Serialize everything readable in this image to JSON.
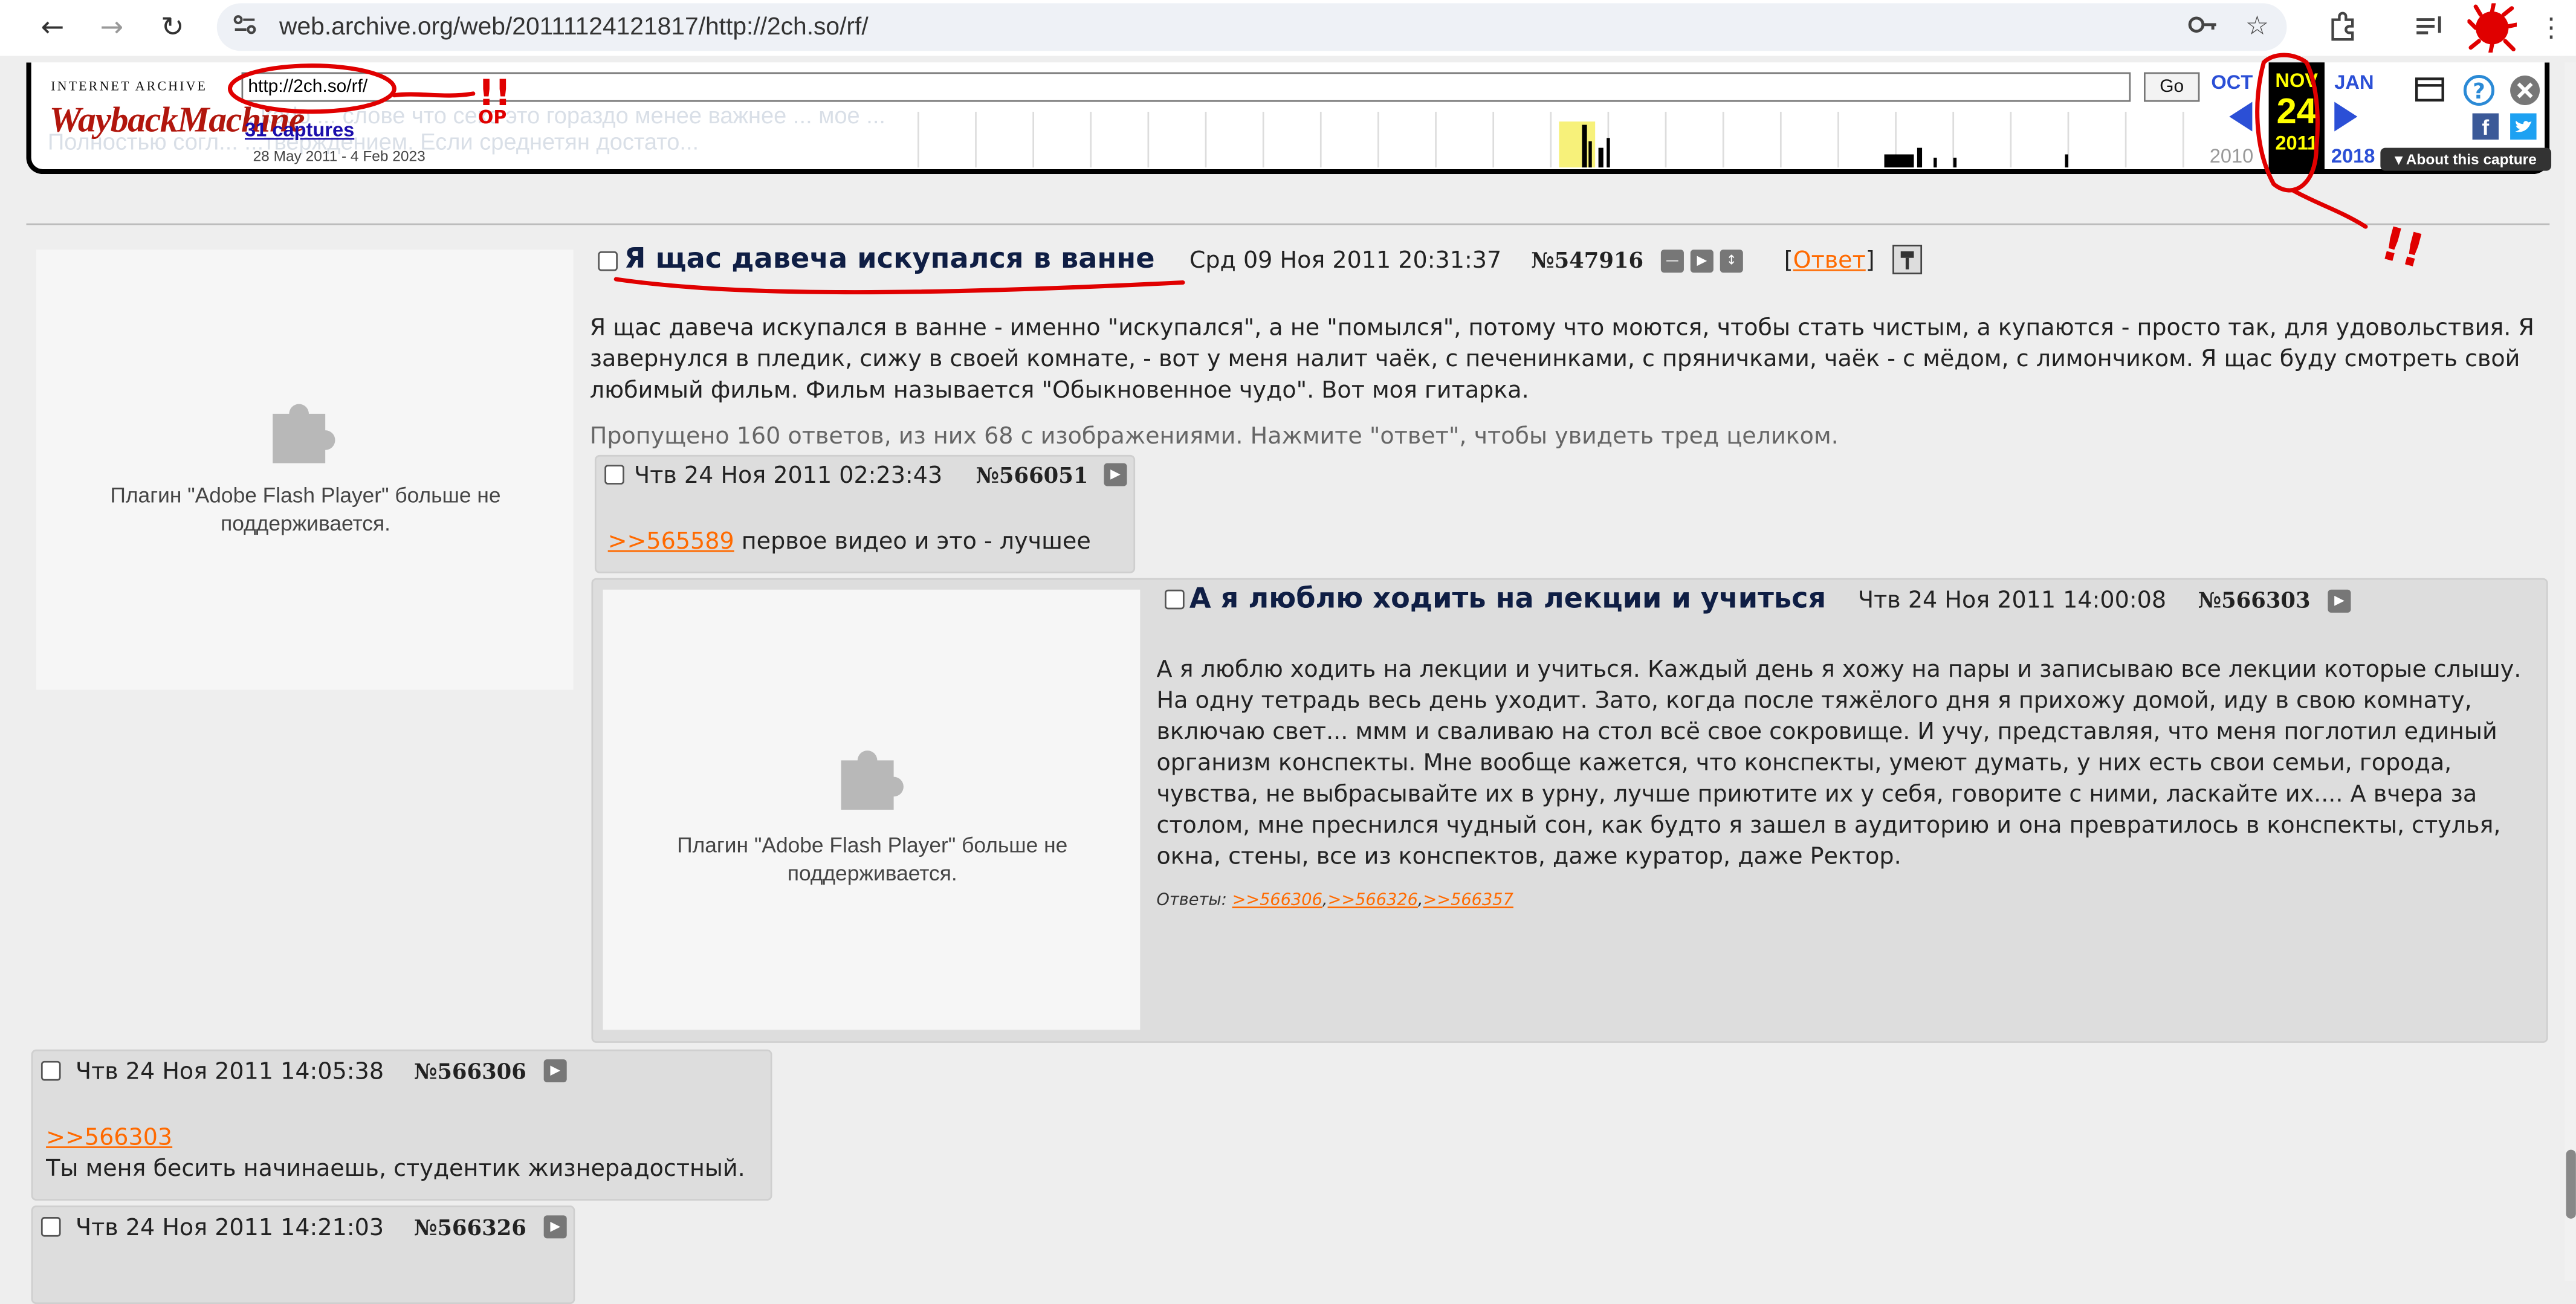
{
  "browser": {
    "url": "web.archive.org/web/20111124121817/http://2ch.so/rf/",
    "icons": [
      "back-icon",
      "forward-icon",
      "reload-icon",
      "site-info-icon",
      "password-key-icon",
      "bookmark-star-icon",
      "extensions-icon",
      "reading-list-icon",
      "profile-avatar-icon",
      "menu-kebab-icon"
    ]
  },
  "wayback": {
    "logo_top": "INTERNET ARCHIVE",
    "logo_main": "WaybackMachine",
    "url_value": "http://2ch.so/rf/",
    "go_label": "Go",
    "captures": "31 captures",
    "range": "28 May 2011 - 4 Feb 2023",
    "months": {
      "prev": "OCT",
      "cur": "NOV",
      "next": "JAN"
    },
    "day": "24",
    "years": {
      "prev": "2010",
      "cur": "2011",
      "next": "2018"
    },
    "about": "About this capture",
    "ghost_line1": "...kado ... слове что секс это гораздо менее важнее ... мое ...",
    "ghost_line2": "Полностью согл... ...тверждением. Если среднетян достато..."
  },
  "plugin_message": "Плагин \"Adobe Flash Player\" больше не поддерживается.",
  "op": {
    "subject": "Я щас давеча искупался в ванне",
    "date": "Срд 09 Ноя 2011 20:31:37",
    "number": "№547916",
    "reply_open": "[",
    "reply_label": "Ответ",
    "reply_close": "]",
    "body": "Я щас давеча искупался в ванне - именно \"искупался\", а не \"помылся\", потому что моются, чтобы стать чистым, а купаются - просто так, для удовольствия. Я завернулся в пледик, сижу в своей комнате, - вот у меня налит чаёк, с печенинками, с пряничками, чаёк - с мёдом, с лимончиком. Я щас буду смотреть свой любимый фильм. Фильм называется \"Обыкновенное чудо\". Вот моя гитарка.",
    "omitted": "Пропущено 160 ответов, из них 68 с изображениями. Нажмите \"ответ\", чтобы увидеть тред целиком."
  },
  "replies": [
    {
      "date": "Чтв 24 Ноя 2011 02:23:43",
      "number": "№566051",
      "link": ">>565589",
      "text": "первое видео и это - лучшее"
    },
    {
      "subject": "А я люблю ходить на лекции и учиться",
      "date": "Чтв 24 Ноя 2011 14:00:08",
      "number": "№566303",
      "text": "А я люблю ходить на лекции и учиться. Каждый день я хожу на пары и записываю все лекции которые слышу. На одну тетрадь весь день уходит. Зато, когда после тяжёлого дня я прихожу домой, иду в свою комнату, включаю свет... ммм и сваливаю на стол всё свое сокровище. И учу, представляя, что меня поглотил единый организм конспекты. Мне вообще кажется, что конспекты, умеют думать, у них есть свои семьи, города, чувства, не выбрасывайте их в урну, лучше приютите их у себя, говорите с ними, ласкайте их.... А вчера за столом, мне преснился чудный сон, как будто я зашел в аудиторию и она превратилось в конспекты, стулья, окна, стены, все из конспектов, даже куратор, даже Ректор.",
      "answers_label": "Ответы:",
      "answers": [
        ">>566306",
        ">>566326",
        ">>566357"
      ]
    },
    {
      "date": "Чтв 24 Ноя 2011 14:05:38",
      "number": "№566306",
      "link": ">>566303",
      "text": "Ты меня бесить начинаешь, студентик жизнерадостный."
    },
    {
      "date": "Чтв 24 Ноя 2011 14:21:03",
      "number": "№566326"
    }
  ],
  "annotations": {
    "marks_left": "!!",
    "marks_left_sub": "ОР",
    "marks_right": "!!"
  },
  "colors": {
    "accent_link": "#ff6a00",
    "subject": "#0f1e44",
    "wayback_red": "#b1160d",
    "wayback_blue": "#2b4fd6",
    "ink_red": "#e00000"
  }
}
